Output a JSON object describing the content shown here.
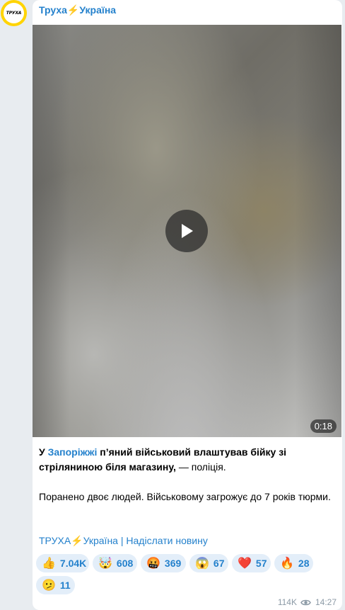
{
  "channel": {
    "avatar_text": "ТРУХА",
    "name_part1": "Труха",
    "bolt": "⚡",
    "name_part2": "Україна"
  },
  "video": {
    "duration": "0:18"
  },
  "post": {
    "p1_prefix": "У ",
    "p1_link": "Запоріжжі",
    "p1_bold": " п’яний військовий влаштував бійку зі стріляниною біля магазину,",
    "p1_suffix": " — поліція.",
    "p2": "Поранено двоє людей. Військовому загрожує до 7 років тюрми."
  },
  "footer": {
    "channel_link_part1": "ТРУХА",
    "bolt": "⚡",
    "channel_link_part2": "Україна",
    "separator": " | ",
    "submit_link": "Надіслати новину"
  },
  "reactions": [
    {
      "emoji": "👍",
      "count": "7.04K",
      "icon": "thumbs-up-icon"
    },
    {
      "emoji": "🤯",
      "count": "608",
      "icon": "exploding-head-icon"
    },
    {
      "emoji": "🤬",
      "count": "369",
      "icon": "swearing-face-icon"
    },
    {
      "emoji": "😱",
      "count": "67",
      "icon": "screaming-face-icon"
    },
    {
      "emoji": "❤️",
      "count": "57",
      "icon": "heart-icon"
    },
    {
      "emoji": "🔥",
      "count": "28",
      "icon": "fire-icon"
    },
    {
      "emoji": "🫤",
      "count": "11",
      "icon": "diagonal-mouth-face-icon"
    }
  ],
  "meta": {
    "views": "114K",
    "time": "14:27"
  },
  "colors": {
    "accent": "#2481cc",
    "avatar_ring": "#ffd400",
    "background": "#e8ecf0"
  }
}
